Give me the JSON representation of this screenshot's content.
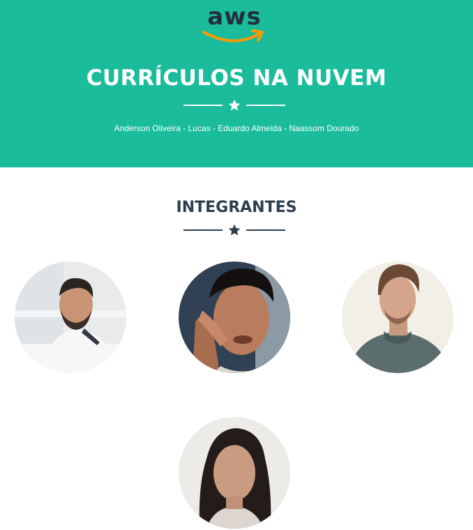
{
  "header": {
    "logo_text": "aws",
    "title": "CURRÍCULOS NA NUVEM",
    "subtitle": "Anderson Oliveira - Lucas - Eduardo Almeida - Naassom Dourado"
  },
  "team_section": {
    "title": "INTEGRANTES",
    "members": [
      {
        "icon": "avatar-photo"
      },
      {
        "icon": "avatar-photo"
      },
      {
        "icon": "avatar-photo"
      },
      {
        "icon": "avatar-photo"
      }
    ]
  },
  "colors": {
    "primary": "#1abc9c",
    "dark": "#2c3e50",
    "aws_orange": "#ff9900",
    "aws_navy": "#232f3e",
    "white": "#ffffff"
  }
}
